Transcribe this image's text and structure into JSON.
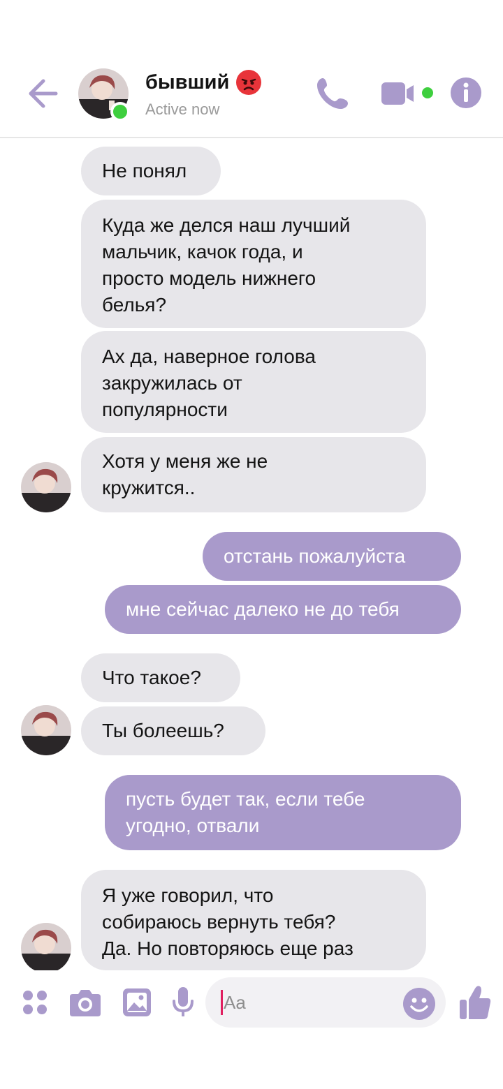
{
  "header": {
    "contact_name": "бывший",
    "status": "Active now",
    "emoji_name": "angry-face",
    "accent_color": "#a99acb",
    "online_color": "#3ecf3e"
  },
  "messages": [
    {
      "side": "incoming",
      "text": "Не понял"
    },
    {
      "side": "incoming",
      "lines": [
        "Куда же делся наш лучший",
        "мальчик, качок года, и",
        "просто модель нижнего",
        "белья?"
      ]
    },
    {
      "side": "incoming",
      "lines": [
        "Ах да, наверное голова",
        "закружилась от",
        "популярности"
      ]
    },
    {
      "side": "incoming",
      "lines": [
        "Хотя у меня же не",
        "кружится.."
      ]
    },
    {
      "side": "outgoing",
      "text": "отстань пожалуйста"
    },
    {
      "side": "outgoing",
      "text": "мне сейчас далеко не до тебя"
    },
    {
      "side": "incoming",
      "text": "Что такое?"
    },
    {
      "side": "incoming",
      "text": "Ты болеешь?"
    },
    {
      "side": "outgoing",
      "lines": [
        "пусть будет так, если тебе",
        "угодно, отвали"
      ]
    },
    {
      "side": "incoming",
      "lines": [
        "Я уже говорил, что",
        "собираюсь вернуть тебя?",
        "Да. Но повторяюсь еще раз"
      ]
    }
  ],
  "composer": {
    "placeholder": "Aa",
    "icons": [
      "apps-icon",
      "camera-icon",
      "gallery-icon",
      "microphone-icon",
      "emoji-icon",
      "thumbs-up-icon"
    ]
  },
  "colors": {
    "incoming_bubble": "#e7e6ea",
    "outgoing_bubble": "#a99acb"
  }
}
